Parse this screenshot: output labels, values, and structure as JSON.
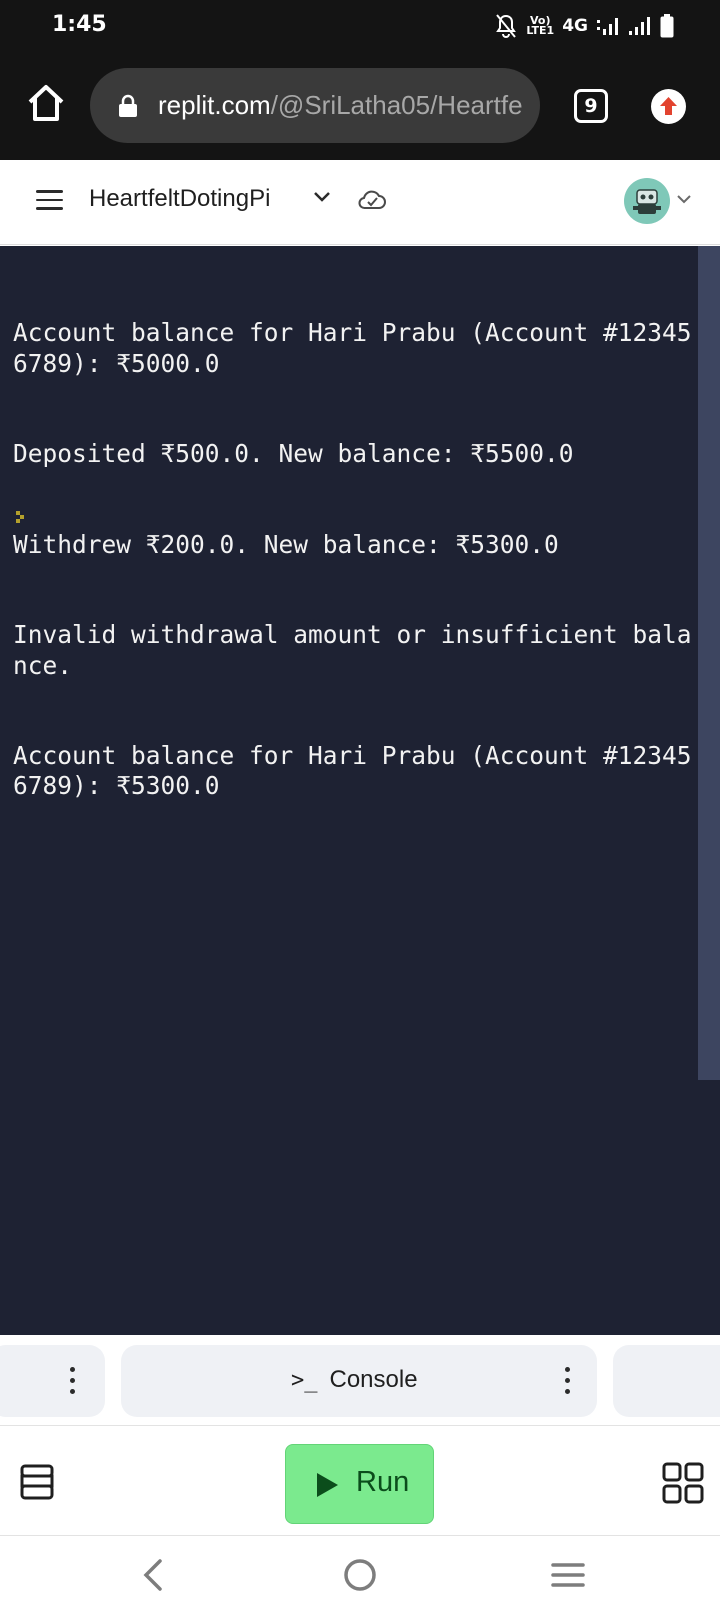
{
  "status_bar": {
    "time": "1:45",
    "lte_label_top": "Vo)",
    "lte_label_bottom": "LTE1",
    "network": "4G"
  },
  "browser": {
    "url_domain": "replit.com",
    "url_path": "/@SriLatha05/Heartfe",
    "tab_count": "9"
  },
  "app_header": {
    "repl_name": "HeartfeltDotingPi"
  },
  "console": {
    "lines": [
      "Account balance for Hari Prabu (Account #123456789): ₹5000.0",
      "Deposited ₹500.0. New balance: ₹5500.0",
      "Withdrew ₹200.0. New balance: ₹5300.0",
      "Invalid withdrawal amount or insufficient balance.",
      "Account balance for Hari Prabu (Account #123456789): ₹5300.0"
    ]
  },
  "tabs": {
    "console_label": "Console",
    "console_prompt": ">_"
  },
  "toolbar": {
    "run_label": "Run"
  },
  "colors": {
    "console_bg": "#1e2233",
    "run_bg": "#7bea8e",
    "run_text": "#0b4d1b",
    "status_bg": "#141414"
  }
}
